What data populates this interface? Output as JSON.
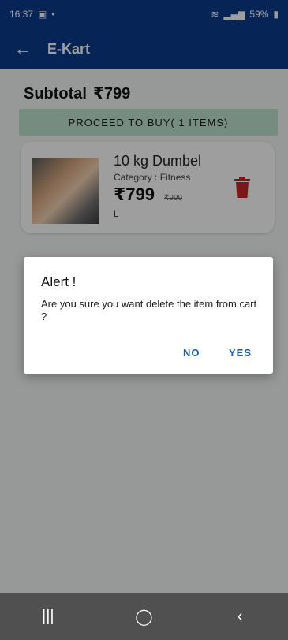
{
  "status_bar": {
    "time": "16:37",
    "battery": "59%"
  },
  "app_bar": {
    "title": "E-Kart"
  },
  "subtotal": {
    "label": "Subtotal",
    "amount": "₹799"
  },
  "proceed_button": {
    "label": "PROCEED TO BUY( 1 ITEMS)"
  },
  "cart_items": [
    {
      "name": "10 kg Dumbel",
      "category": "Category : Fitness",
      "price": "₹799",
      "mrp": "₹999",
      "size": "L"
    }
  ],
  "dialog": {
    "title": "Alert !",
    "message": "Are you sure you want delete the item from cart ?",
    "no_label": "NO",
    "yes_label": "YES"
  },
  "colors": {
    "primary": "#0b3c8c",
    "proceed_bg": "#bfe3cf",
    "delete": "#c62828",
    "dialog_button": "#1b5fb8"
  }
}
